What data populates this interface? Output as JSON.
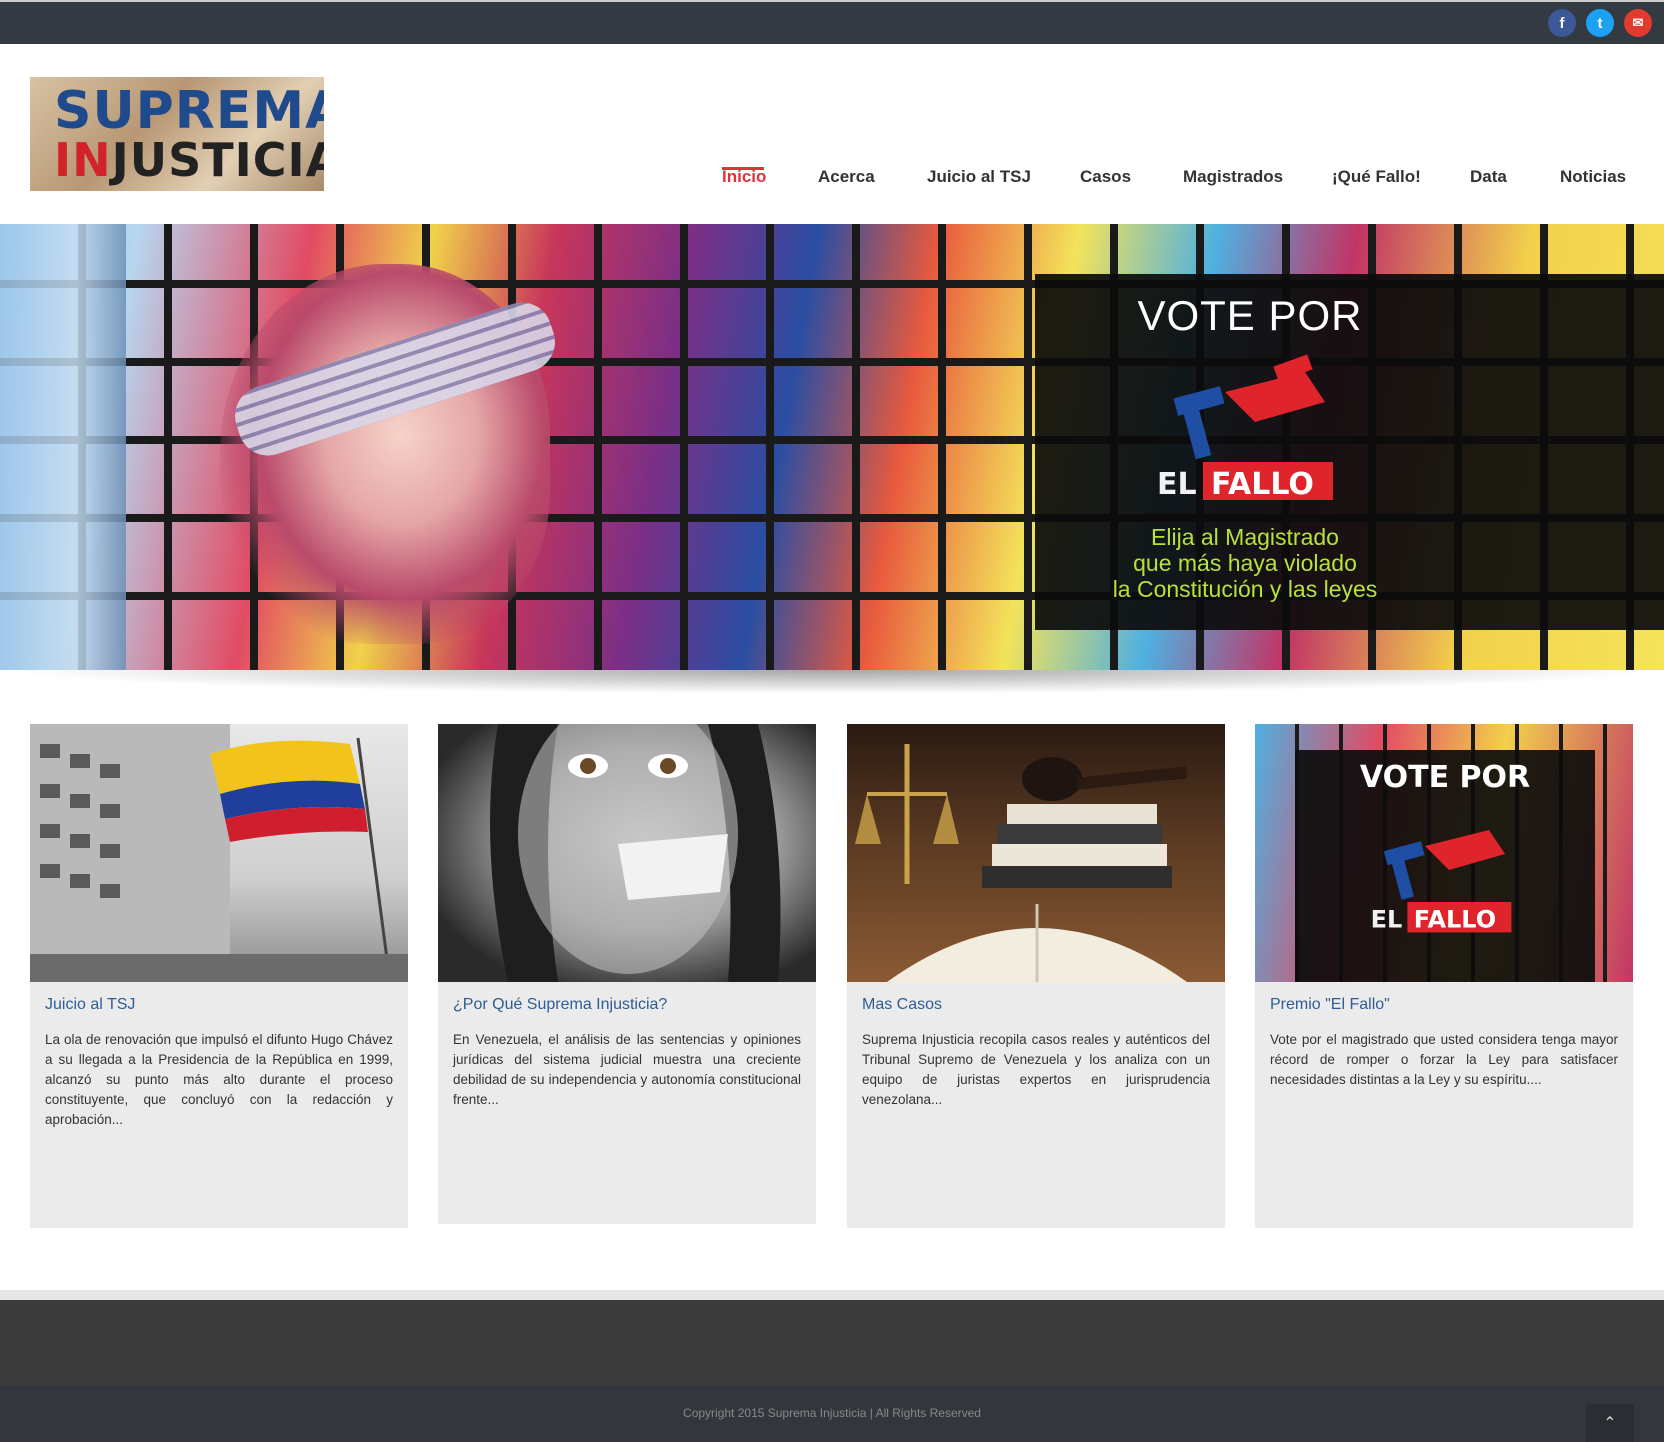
{
  "social": {
    "facebook_glyph": "f",
    "twitter_glyph": "t",
    "email_glyph": "✉"
  },
  "logo": {
    "line1": "SUPREMA",
    "line2_in": "IN",
    "line2_rest": "JUSTICIA"
  },
  "nav": {
    "items": [
      {
        "label": "Inicio",
        "active": true
      },
      {
        "label": "Acerca"
      },
      {
        "label": "Juicio al TSJ"
      },
      {
        "label": "Casos"
      },
      {
        "label": "Magistrados"
      },
      {
        "label": "¡Qué Fallo!"
      },
      {
        "label": "Data"
      },
      {
        "label": "Noticias"
      }
    ]
  },
  "hero": {
    "title": "VOTE POR",
    "logo_el": "EL",
    "logo_fallo": "FALLO",
    "caption_line1": "Elija al Magistrado",
    "caption_line2": "que más haya violado",
    "caption_line3": "la Constitución y las leyes"
  },
  "cards": [
    {
      "title": "Juicio al TSJ",
      "text": "La ola de renovación que impulsó el difunto Hugo Chávez a su llegada a la Presidencia de la República en 1999, alcanzó su punto más alto durante el proceso constituyente, que concluyó con la redacción y aprobación..."
    },
    {
      "title": "¿Por Qué Suprema Injusticia?",
      "text": "En Venezuela, el análisis de las sentencias y opiniones jurídicas del sistema judicial muestra una creciente debilidad de su independencia y autonomía constitucional frente..."
    },
    {
      "title": "Mas Casos",
      "text": "Suprema Injusticia recopila casos reales y auténticos del Tribunal Supremo de Venezuela y los analiza con un equipo de juristas expertos en jurisprudencia venezolana..."
    },
    {
      "title": "Premio \"El Fallo\"",
      "text": "Vote por el magistrado que usted considera tenga mayor récord de romper o forzar la Ley para satisfacer necesidades distintas a la Ley y su espíritu....",
      "img_title": "VOTE POR",
      "img_el": "EL",
      "img_fallo": "FALLO"
    }
  ],
  "footer": {
    "copyright": "Copyright 2015 Suprema Injusticia | All Rights Reserved",
    "to_top_glyph": "⌃"
  },
  "colors": {
    "accent": "#e0323a",
    "topbar": "#343a42",
    "link": "#2e5d95",
    "caption": "#b7e23a"
  }
}
